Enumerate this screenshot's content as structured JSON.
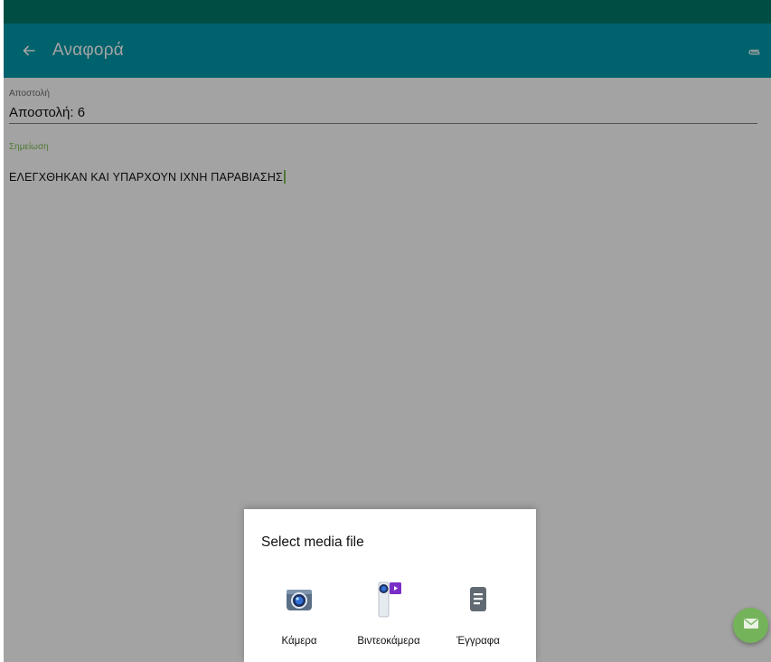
{
  "app_bar": {
    "title": "Αναφορά",
    "back_icon": "arrow-back-icon",
    "attach_icon": "paperclip-icon"
  },
  "form": {
    "dispatch_label": "Αποστολή",
    "dispatch_value": "Αποστολή: 6",
    "note_label": "Σημείωση",
    "note_value": "ΕΛΕΓΧΘΗΚΑΝ ΚΑΙ ΥΠΑΡΧΟΥΝ ΙΧΝΗ ΠΑΡΑΒΙΑΣΗΣ"
  },
  "media_dialog": {
    "title": "Select media file",
    "options": [
      {
        "label": "Κάμερα",
        "icon": "camera-icon"
      },
      {
        "label": "Βιντεοκάμερα",
        "icon": "video-camera-icon"
      },
      {
        "label": "Έγγραφα",
        "icon": "document-icon"
      }
    ]
  },
  "fab": {
    "icon": "mail-icon"
  },
  "colors": {
    "status_bar": "#00796b",
    "app_bar": "#009aa9",
    "accent": "#7fbf55",
    "fab": "#74b35a"
  }
}
